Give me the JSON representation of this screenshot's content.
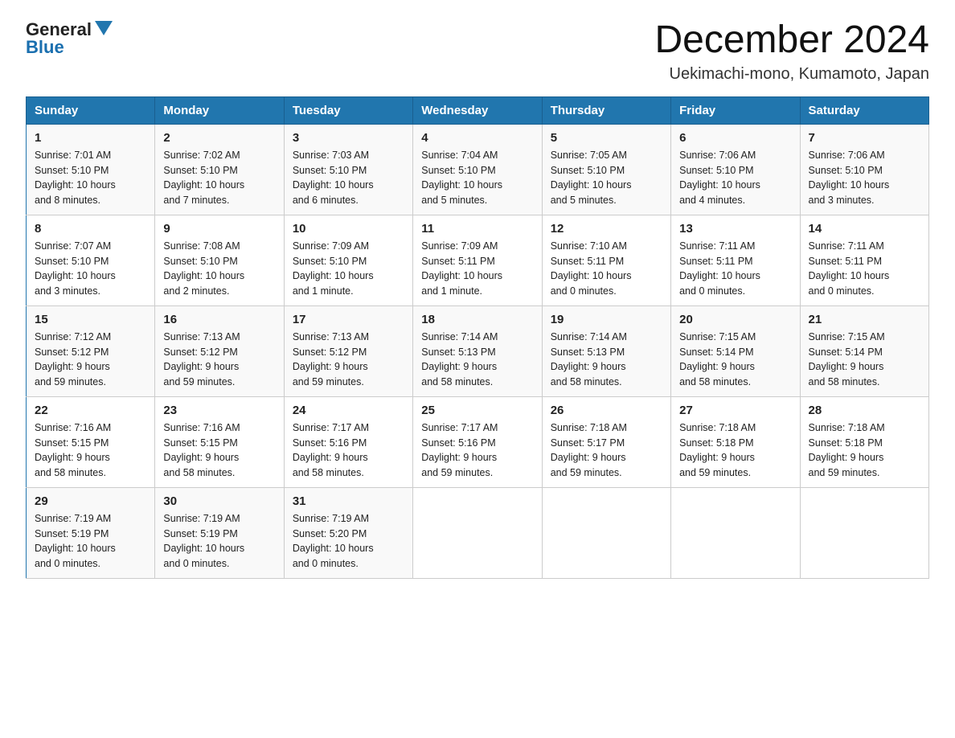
{
  "logo": {
    "text_general": "General",
    "text_blue": "Blue"
  },
  "title": "December 2024",
  "subtitle": "Uekimachi-mono, Kumamoto, Japan",
  "days_of_week": [
    "Sunday",
    "Monday",
    "Tuesday",
    "Wednesday",
    "Thursday",
    "Friday",
    "Saturday"
  ],
  "weeks": [
    [
      {
        "day": "1",
        "info": "Sunrise: 7:01 AM\nSunset: 5:10 PM\nDaylight: 10 hours\nand 8 minutes."
      },
      {
        "day": "2",
        "info": "Sunrise: 7:02 AM\nSunset: 5:10 PM\nDaylight: 10 hours\nand 7 minutes."
      },
      {
        "day": "3",
        "info": "Sunrise: 7:03 AM\nSunset: 5:10 PM\nDaylight: 10 hours\nand 6 minutes."
      },
      {
        "day": "4",
        "info": "Sunrise: 7:04 AM\nSunset: 5:10 PM\nDaylight: 10 hours\nand 5 minutes."
      },
      {
        "day": "5",
        "info": "Sunrise: 7:05 AM\nSunset: 5:10 PM\nDaylight: 10 hours\nand 5 minutes."
      },
      {
        "day": "6",
        "info": "Sunrise: 7:06 AM\nSunset: 5:10 PM\nDaylight: 10 hours\nand 4 minutes."
      },
      {
        "day": "7",
        "info": "Sunrise: 7:06 AM\nSunset: 5:10 PM\nDaylight: 10 hours\nand 3 minutes."
      }
    ],
    [
      {
        "day": "8",
        "info": "Sunrise: 7:07 AM\nSunset: 5:10 PM\nDaylight: 10 hours\nand 3 minutes."
      },
      {
        "day": "9",
        "info": "Sunrise: 7:08 AM\nSunset: 5:10 PM\nDaylight: 10 hours\nand 2 minutes."
      },
      {
        "day": "10",
        "info": "Sunrise: 7:09 AM\nSunset: 5:10 PM\nDaylight: 10 hours\nand 1 minute."
      },
      {
        "day": "11",
        "info": "Sunrise: 7:09 AM\nSunset: 5:11 PM\nDaylight: 10 hours\nand 1 minute."
      },
      {
        "day": "12",
        "info": "Sunrise: 7:10 AM\nSunset: 5:11 PM\nDaylight: 10 hours\nand 0 minutes."
      },
      {
        "day": "13",
        "info": "Sunrise: 7:11 AM\nSunset: 5:11 PM\nDaylight: 10 hours\nand 0 minutes."
      },
      {
        "day": "14",
        "info": "Sunrise: 7:11 AM\nSunset: 5:11 PM\nDaylight: 10 hours\nand 0 minutes."
      }
    ],
    [
      {
        "day": "15",
        "info": "Sunrise: 7:12 AM\nSunset: 5:12 PM\nDaylight: 9 hours\nand 59 minutes."
      },
      {
        "day": "16",
        "info": "Sunrise: 7:13 AM\nSunset: 5:12 PM\nDaylight: 9 hours\nand 59 minutes."
      },
      {
        "day": "17",
        "info": "Sunrise: 7:13 AM\nSunset: 5:12 PM\nDaylight: 9 hours\nand 59 minutes."
      },
      {
        "day": "18",
        "info": "Sunrise: 7:14 AM\nSunset: 5:13 PM\nDaylight: 9 hours\nand 58 minutes."
      },
      {
        "day": "19",
        "info": "Sunrise: 7:14 AM\nSunset: 5:13 PM\nDaylight: 9 hours\nand 58 minutes."
      },
      {
        "day": "20",
        "info": "Sunrise: 7:15 AM\nSunset: 5:14 PM\nDaylight: 9 hours\nand 58 minutes."
      },
      {
        "day": "21",
        "info": "Sunrise: 7:15 AM\nSunset: 5:14 PM\nDaylight: 9 hours\nand 58 minutes."
      }
    ],
    [
      {
        "day": "22",
        "info": "Sunrise: 7:16 AM\nSunset: 5:15 PM\nDaylight: 9 hours\nand 58 minutes."
      },
      {
        "day": "23",
        "info": "Sunrise: 7:16 AM\nSunset: 5:15 PM\nDaylight: 9 hours\nand 58 minutes."
      },
      {
        "day": "24",
        "info": "Sunrise: 7:17 AM\nSunset: 5:16 PM\nDaylight: 9 hours\nand 58 minutes."
      },
      {
        "day": "25",
        "info": "Sunrise: 7:17 AM\nSunset: 5:16 PM\nDaylight: 9 hours\nand 59 minutes."
      },
      {
        "day": "26",
        "info": "Sunrise: 7:18 AM\nSunset: 5:17 PM\nDaylight: 9 hours\nand 59 minutes."
      },
      {
        "day": "27",
        "info": "Sunrise: 7:18 AM\nSunset: 5:18 PM\nDaylight: 9 hours\nand 59 minutes."
      },
      {
        "day": "28",
        "info": "Sunrise: 7:18 AM\nSunset: 5:18 PM\nDaylight: 9 hours\nand 59 minutes."
      }
    ],
    [
      {
        "day": "29",
        "info": "Sunrise: 7:19 AM\nSunset: 5:19 PM\nDaylight: 10 hours\nand 0 minutes."
      },
      {
        "day": "30",
        "info": "Sunrise: 7:19 AM\nSunset: 5:19 PM\nDaylight: 10 hours\nand 0 minutes."
      },
      {
        "day": "31",
        "info": "Sunrise: 7:19 AM\nSunset: 5:20 PM\nDaylight: 10 hours\nand 0 minutes."
      },
      {
        "day": "",
        "info": ""
      },
      {
        "day": "",
        "info": ""
      },
      {
        "day": "",
        "info": ""
      },
      {
        "day": "",
        "info": ""
      }
    ]
  ]
}
